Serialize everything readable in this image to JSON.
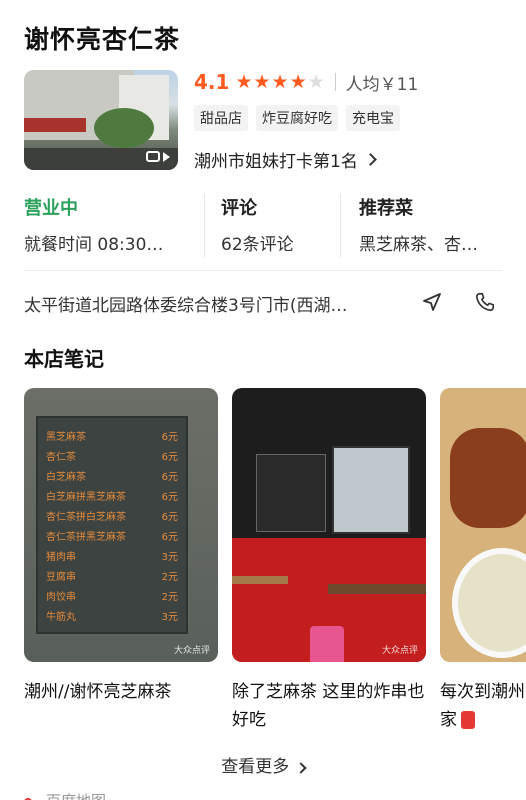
{
  "shop": {
    "name": "谢怀亮杏仁茶",
    "score": "4.1",
    "stars_filled": 4,
    "stars_total": 5,
    "avg_price": "人均￥11",
    "tags": [
      "甜品店",
      "炸豆腐好吃",
      "充电宝"
    ],
    "rank": "潮州市姐妹打卡第1名",
    "address": "太平街道北园路体委综合楼3号门市(西湖…"
  },
  "info": {
    "status_label": "营业中",
    "hours": "就餐时间 08:30…",
    "reviews_label": "评论",
    "reviews_value": "62条评论",
    "recommend_label": "推荐菜",
    "recommend_value": "黑芝麻茶、杏…"
  },
  "notes": {
    "title": "本店笔记",
    "cards": [
      {
        "caption": "潮州//谢怀亮芝麻茶"
      },
      {
        "caption": "除了芝麻茶 这里的炸串也好吃"
      },
      {
        "caption_line1": "每次到潮州",
        "caption_line2": "家"
      }
    ],
    "more": "查看更多",
    "watermark": "大众点评"
  },
  "menu_board": [
    {
      "name": "黑芝麻茶",
      "price": "6元"
    },
    {
      "name": "杏仁茶",
      "price": "6元"
    },
    {
      "name": "白芝麻茶",
      "price": "6元"
    },
    {
      "name": "白芝麻拼黑芝麻茶",
      "price": "6元"
    },
    {
      "name": "杏仁茶拼白芝麻茶",
      "price": "6元"
    },
    {
      "name": "杏仁茶拼黑芝麻茶",
      "price": "6元"
    },
    {
      "name": "猪肉串",
      "price": "3元"
    },
    {
      "name": "豆腐串",
      "price": "2元"
    },
    {
      "name": "肉饺串",
      "price": "2元"
    },
    {
      "name": "牛筋丸",
      "price": "3元"
    }
  ],
  "bottom": {
    "text": "百度地图"
  },
  "colors": {
    "accent": "#ff5a1f",
    "open_green": "#2aa05a"
  }
}
